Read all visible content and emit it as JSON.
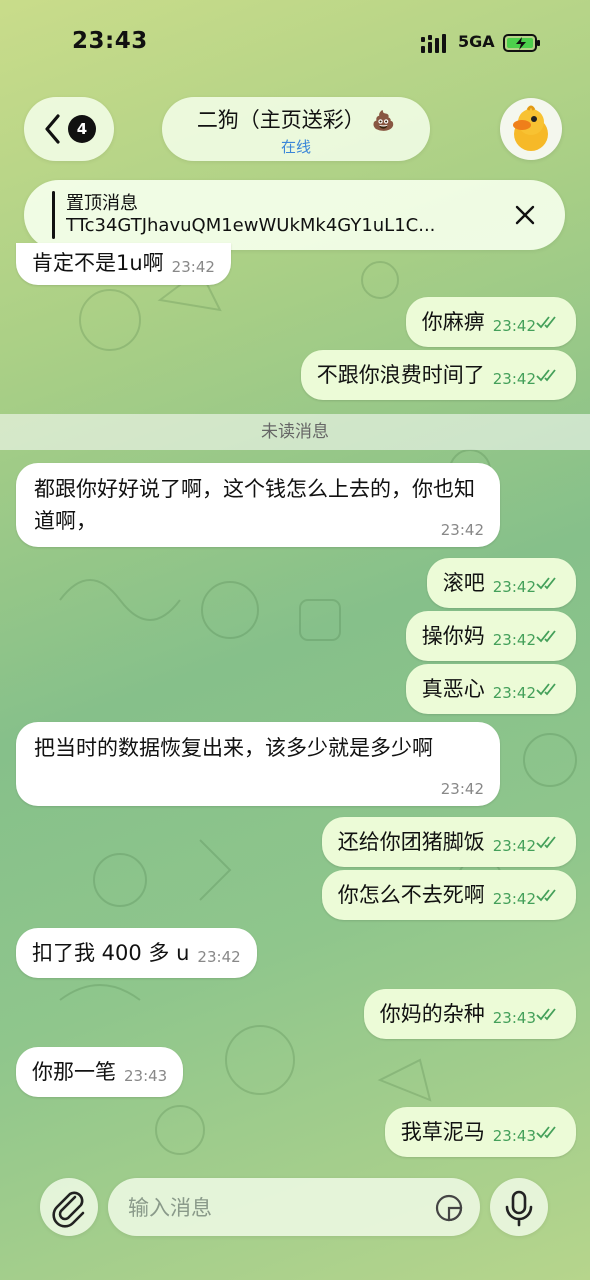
{
  "status_bar": {
    "time": "23:43",
    "network": "5GA"
  },
  "header": {
    "back_badge": "4",
    "title": "二狗（主页送彩）",
    "title_icon": "💩",
    "status": "在线"
  },
  "pinned": {
    "title": "置顶消息",
    "text": "TTc34GTJhavuQM1ewWUkMk4GY1uL1C..."
  },
  "top_partial_message": {
    "text": "肯定不是1u啊",
    "time": "23:42"
  },
  "unread_label": "未读消息",
  "messages": [
    {
      "dir": "out",
      "text": "你麻痹",
      "time": "23:42"
    },
    {
      "dir": "out",
      "text": "不跟你浪费时间了",
      "time": "23:42"
    },
    {
      "dir": "in",
      "text": "都跟你好好说了啊，这个钱怎么上去的，你也知道啊，",
      "time": "23:42"
    },
    {
      "dir": "out",
      "text": "滚吧",
      "time": "23:42"
    },
    {
      "dir": "out",
      "text": "操你妈",
      "time": "23:42"
    },
    {
      "dir": "out",
      "text": "真恶心",
      "time": "23:42"
    },
    {
      "dir": "in",
      "text": "把当时的数据恢复出来，该多少就是多少啊",
      "time": "23:42"
    },
    {
      "dir": "out",
      "text": "还给你团猪脚饭",
      "time": "23:42"
    },
    {
      "dir": "out",
      "text": "你怎么不去死啊",
      "time": "23:42"
    },
    {
      "dir": "in",
      "text": "扣了我 400 多 u",
      "time": "23:42"
    },
    {
      "dir": "out",
      "text": "你妈的杂种",
      "time": "23:43"
    },
    {
      "dir": "in",
      "text": "你那一笔",
      "time": "23:43"
    },
    {
      "dir": "out",
      "text": "我草泥马",
      "time": "23:43"
    }
  ],
  "composer": {
    "placeholder": "输入消息"
  },
  "icons": {
    "back": "chevron-left-icon",
    "close": "close-icon",
    "attach": "paperclip-icon",
    "sticker": "sticker-icon",
    "mic": "microphone-icon",
    "read": "double-check-icon"
  },
  "colors": {
    "incoming_bubble": "#ffffff",
    "outgoing_bubble": "#ecfbd7",
    "outgoing_time": "#44a05a",
    "online": "#3a86d8"
  }
}
